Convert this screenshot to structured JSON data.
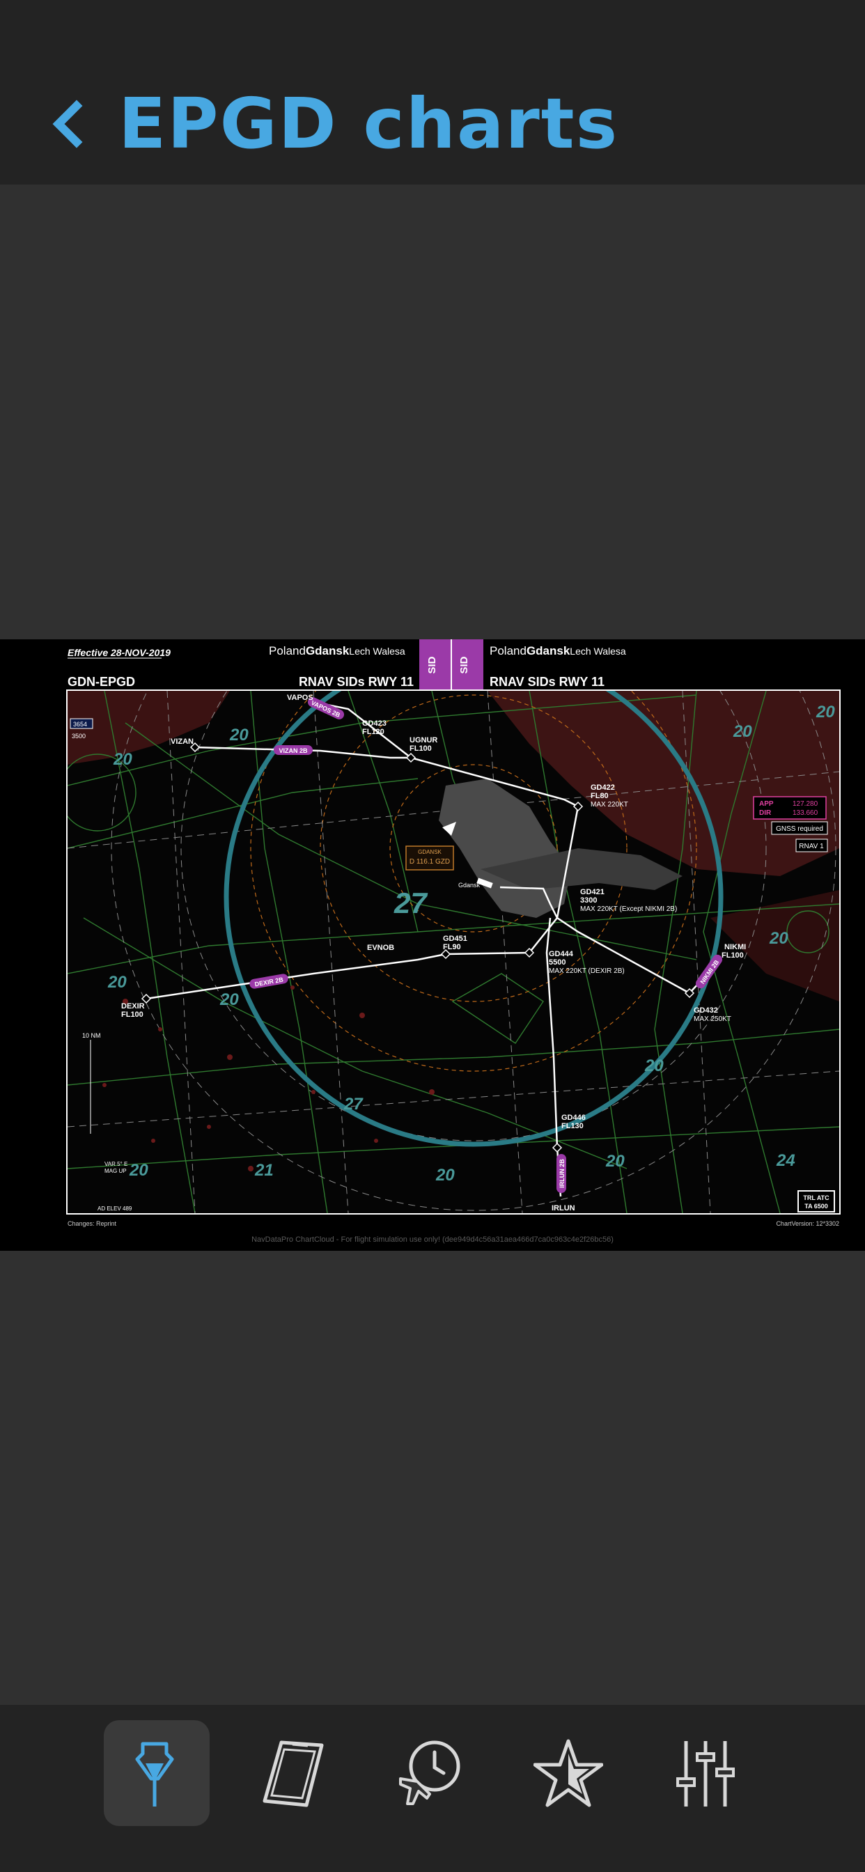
{
  "header": {
    "title": "EPGD charts",
    "back_icon": "chevron-left-icon",
    "accent": "#48a8e2"
  },
  "chart": {
    "effective": "Effective 28-NOV-2019",
    "airport_left": {
      "country": "Poland",
      "city": "Gdansk",
      "name": "Lech Walesa"
    },
    "airport_right": {
      "country": "Poland",
      "city": "Gdansk",
      "name": "Lech Walesa"
    },
    "badge": "SID",
    "code": "GDN-EPGD",
    "proc_left": "RNAV SIDs RWY 11",
    "proc_right": "RNAV SIDs RWY 11",
    "footer_left": "Changes: Reprint",
    "footer_right": "ChartVersion: 12*3302",
    "footer_center": "NavDataPro ChartCloud - For flight simulation use only! (dee949d4c56a31aea466d7ca0c963c4e2f26bc56)",
    "freq": {
      "app_label": "APP",
      "app": "127.280",
      "dir_label": "DIR",
      "dir": "133.660"
    },
    "gnss": "GNSS required",
    "rnav": "RNAV 1",
    "trl": "TRL ATC",
    "ta": "TA 6500",
    "vor": {
      "name": "GDANSK",
      "freq": "D 116.1 GZD"
    },
    "scale": "10 NM",
    "var": "VAR 5° E",
    "var2": "MAG UP",
    "ad_elev": "AD ELEV 489",
    "msa_top": "3654",
    "msa_bot": "3500",
    "waypoints": [
      {
        "id": "VAPOS",
        "label": "VAPOS"
      },
      {
        "id": "vizan",
        "label": "VIZAN"
      },
      {
        "id": "gd423",
        "label": "GD423",
        "sub": "FL120"
      },
      {
        "id": "ugnur",
        "label": "UGNUR",
        "sub": "FL100"
      },
      {
        "id": "gd422",
        "label": "GD422",
        "sub": "FL80",
        "sub2": "MAX 220KT"
      },
      {
        "id": "gd421",
        "label": "GD421",
        "sub": "3300",
        "sub2": "MAX 220KT (Except NIKMI 2B)"
      },
      {
        "id": "gd451",
        "label": "GD451",
        "sub": "FL90"
      },
      {
        "id": "evnob",
        "label": "EVNOB"
      },
      {
        "id": "gd444",
        "label": "GD444",
        "sub": "5500",
        "sub2": "MAX 220KT (DEXIR 2B)"
      },
      {
        "id": "nikmi",
        "label": "NIKMI",
        "sub": "FL100"
      },
      {
        "id": "gd432",
        "label": "GD432",
        "sub": "MAX 250KT"
      },
      {
        "id": "dexir",
        "label": "DEXIR",
        "sub": "FL100"
      },
      {
        "id": "gd446",
        "label": "GD446",
        "sub": "FL130"
      },
      {
        "id": "irlun",
        "label": "IRLUN"
      }
    ],
    "procedures": [
      "VAPOS 2B",
      "VIZAN 2B",
      "DEXIR 2B",
      "NIKMI 2B",
      "IRLUN 2B"
    ],
    "msa_sectors": [
      "20",
      "20",
      "20",
      "20",
      "20",
      "20",
      "27",
      "27",
      "20",
      "20",
      "20",
      "21",
      "20",
      "24",
      "20"
    ]
  },
  "tabs": [
    {
      "id": "airports",
      "icon": "airport-tower-icon",
      "active": true
    },
    {
      "id": "charts",
      "icon": "chart-document-icon",
      "active": false
    },
    {
      "id": "flights",
      "icon": "flight-schedule-icon",
      "active": false
    },
    {
      "id": "favorites",
      "icon": "star-icon",
      "active": false
    },
    {
      "id": "settings",
      "icon": "sliders-icon",
      "active": false
    }
  ]
}
